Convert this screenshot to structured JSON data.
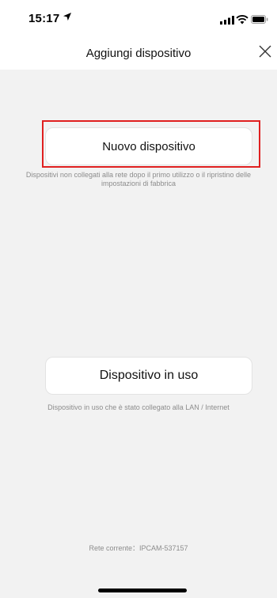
{
  "status_bar": {
    "time": "15:17",
    "icons": [
      "location-arrow-icon",
      "signal-icon",
      "wifi-icon",
      "battery-icon"
    ]
  },
  "header": {
    "title": "Aggiungi dispositivo",
    "close_icon": "close-icon"
  },
  "main": {
    "new_device": {
      "label": "Nuovo dispositivo",
      "description": "Dispositivi non collegati alla rete dopo il primo utilizzo o il ripristino delle impostazioni di fabbrica"
    },
    "in_use_device": {
      "label": "Dispositivo in uso",
      "description": "Dispositivo in uso che è stato collegato alla LAN / Internet"
    },
    "current_network": "Rete corrente：IPCAM-537157"
  },
  "colors": {
    "background": "#f2f2f2",
    "card": "#ffffff",
    "highlight": "#e02020",
    "muted_text": "#8c8c8c"
  }
}
